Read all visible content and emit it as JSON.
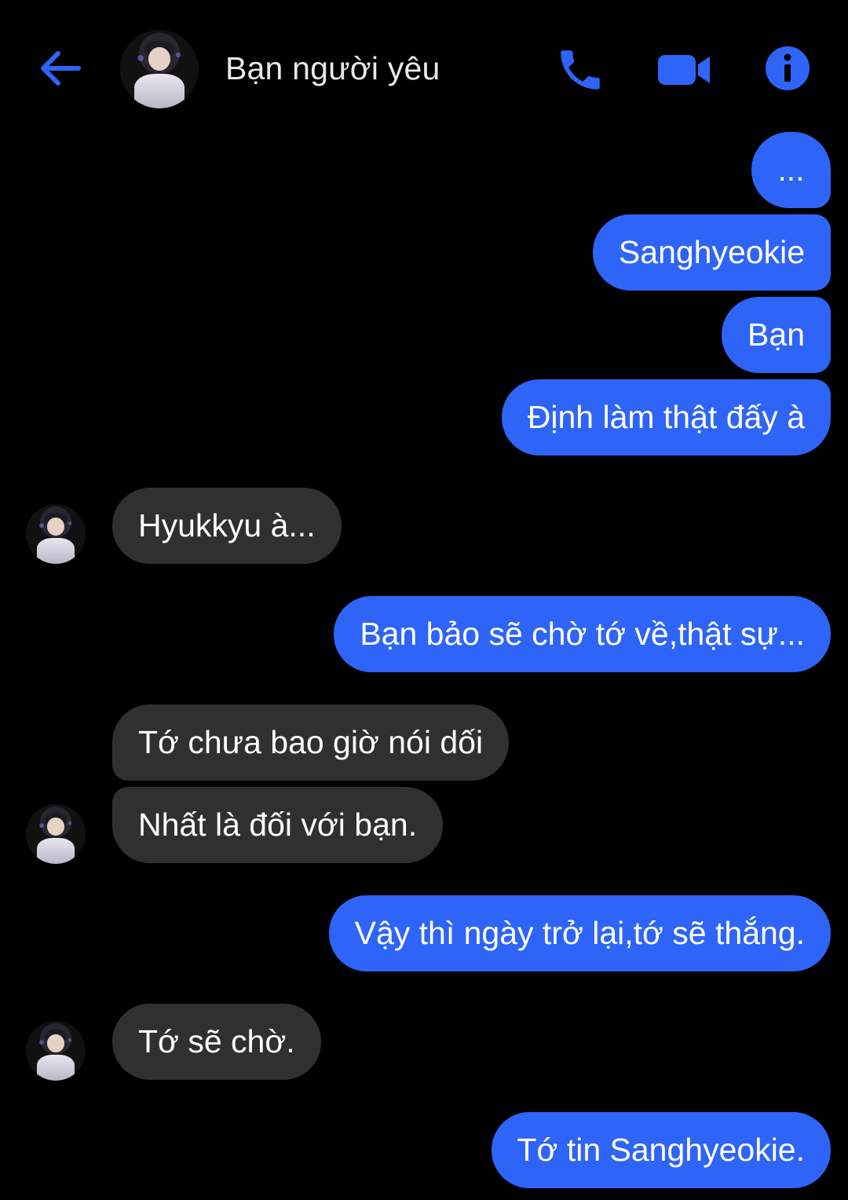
{
  "header": {
    "contact_name": "Bạn người yêu",
    "back_icon": "arrow-left-icon",
    "call_icon": "phone-icon",
    "video_icon": "video-camera-icon",
    "info_icon": "info-icon"
  },
  "colors": {
    "background": "#000000",
    "accent": "#2e64f8",
    "outgoing_bubble": "#2e64f8",
    "incoming_bubble": "#303030"
  },
  "messages": [
    {
      "sender": "me",
      "text": "..."
    },
    {
      "sender": "me",
      "text": "Sanghyeokie"
    },
    {
      "sender": "me",
      "text": "Bạn"
    },
    {
      "sender": "me",
      "text": "Định làm thật đấy à"
    },
    {
      "sender": "contact",
      "text": "Hyukkyu à..."
    },
    {
      "sender": "me",
      "text": "Bạn bảo sẽ chờ tớ về,thật sự..."
    },
    {
      "sender": "contact",
      "text": "Tớ chưa bao giờ nói dối"
    },
    {
      "sender": "contact",
      "text": "Nhất là đối với bạn."
    },
    {
      "sender": "me",
      "text": "Vậy thì ngày trở lại,tớ sẽ thắng."
    },
    {
      "sender": "contact",
      "text": "Tớ sẽ chờ."
    },
    {
      "sender": "me",
      "text": "Tớ tin Sanghyeokie."
    }
  ]
}
